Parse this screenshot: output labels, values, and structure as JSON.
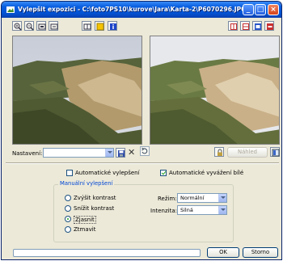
{
  "window": {
    "title": "Vylepšit expozici - C:\\foto7PS10\\kurove\\Jara\\Karta-2\\P6070296.JPG",
    "minimize_glyph": "_",
    "maximize_glyph": "□",
    "close_glyph": "×"
  },
  "toolbar": {
    "left_tools": [
      "zoom-in-icon",
      "zoom-out-icon",
      "fit-window-icon",
      "actual-size-icon",
      "split-view-icon",
      "highlight-icon",
      "info-icon"
    ],
    "right_tools": [
      "layout-side-by-side-icon",
      "layout-top-bottom-icon",
      "layout-single-icon",
      "layout-close-icon"
    ]
  },
  "settings": {
    "label": "Nastavení:",
    "value": "",
    "preview_button": "Náhled"
  },
  "options": {
    "auto_enhance_label": "Automatické vylepšení",
    "auto_enhance_checked": false,
    "auto_white_balance_label": "Automatické vyvážení bílé",
    "auto_white_balance_checked": true
  },
  "manual": {
    "group_title": "Manuální vylepšení",
    "radios": [
      {
        "label": "Zvýšit kontrast",
        "checked": false
      },
      {
        "label": "Snížit kontrast",
        "checked": false
      },
      {
        "label": "Zjasnit",
        "checked": true
      },
      {
        "label": "Ztmavit",
        "checked": false
      }
    ],
    "mode_label": "Režim:",
    "mode_value": "Normální",
    "intensity_label": "Intenzita:",
    "intensity_value": "Silná"
  },
  "footer": {
    "progress": 0,
    "ok_label": "OK",
    "cancel_label": "Storno"
  }
}
